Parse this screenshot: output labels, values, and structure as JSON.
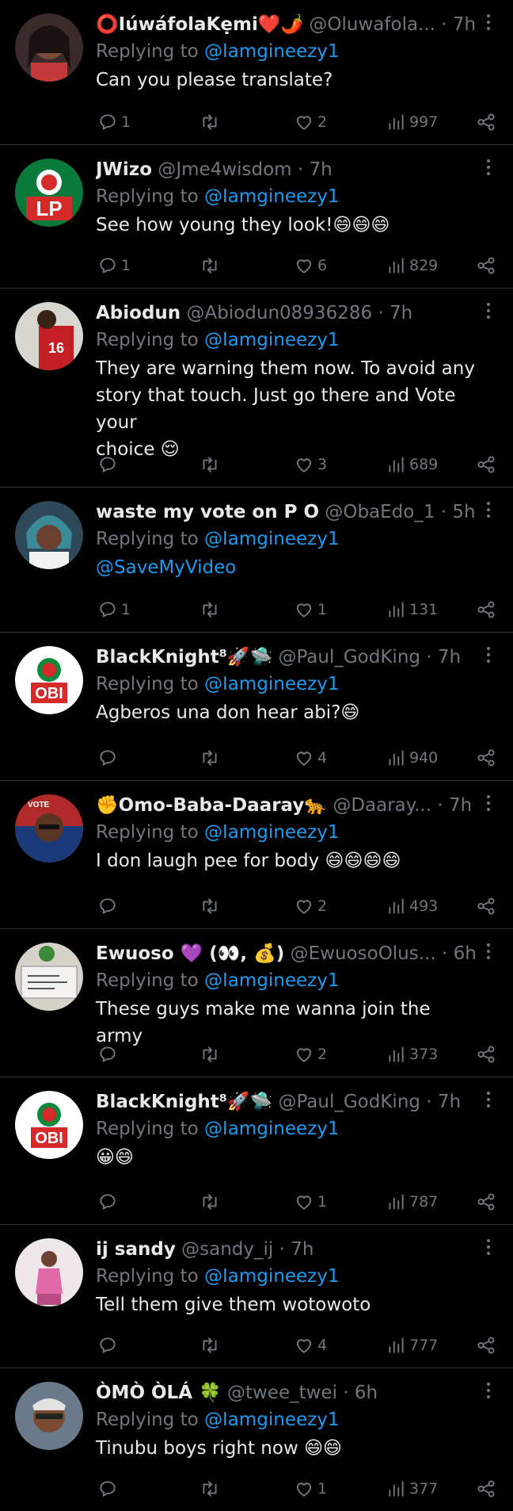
{
  "colors": {
    "background": "#000000",
    "text": "#e7e9ea",
    "muted": "#71767b",
    "link": "#1d9bf0",
    "divider": "#2f3336"
  },
  "icons": {
    "reply": "speech-bubble-icon",
    "retweet": "retweet-arrows-icon",
    "like": "heart-icon",
    "views": "bar-chart-icon",
    "share": "share-nodes-icon",
    "more": "vertical-dots-icon"
  },
  "tweets": [
    {
      "name": "⭕IúwáfolaKẹmi❤️🌶️",
      "handle": "@Oluwafola...",
      "time": "· 7h",
      "replying_prefix": "Replying to ",
      "replying_to": "@Iamgineezy1",
      "text": "Can you please translate?",
      "replies": "1",
      "retweets": "",
      "likes": "2",
      "views": "997"
    },
    {
      "name": "JWizo",
      "handle": "@Jme4wisdom",
      "time": "· 7h",
      "replying_prefix": "Replying to ",
      "replying_to": "@Iamgineezy1",
      "text": "See how young they look!😄😄😄",
      "replies": "1",
      "retweets": "",
      "likes": "6",
      "views": "829"
    },
    {
      "name": "Abiodun",
      "handle": "@Abiodun08936286",
      "time": "· 7h",
      "replying_prefix": "Replying to ",
      "replying_to": "@Iamgineezy1",
      "text": "They are warning them now. To avoid any\nstory that touch. Just go there and Vote your\nchoice 😌",
      "replies": "",
      "retweets": "",
      "likes": "3",
      "views": "689"
    },
    {
      "name": "waste my vote on P O",
      "handle": "@ObaEdo_1",
      "time": "· 5h",
      "replying_prefix": "Replying to ",
      "replying_to": "@Iamgineezy1",
      "text": "@SaveMyVideo",
      "text_is_link": true,
      "replies": "1",
      "retweets": "",
      "likes": "1",
      "views": "131"
    },
    {
      "name": "BlackKnight⁸🚀🛸",
      "handle": "@Paul_GodKing",
      "time": "· 7h",
      "replying_prefix": "Replying to ",
      "replying_to": "@Iamgineezy1",
      "text": "Agberos una don hear abi?😄",
      "replies": "",
      "retweets": "",
      "likes": "4",
      "views": "940"
    },
    {
      "name": "✊Omo-Baba-Daaray🐆",
      "handle": "@Daaray...",
      "time": "· 7h",
      "replying_prefix": "Replying to ",
      "replying_to": "@Iamgineezy1",
      "text": "I don laugh pee for body 😄😄😄😄",
      "replies": "",
      "retweets": "",
      "likes": "2",
      "views": "493"
    },
    {
      "name": "Ewuoso 💜 (👀, 💰)",
      "handle": "@EwuosoOlus...",
      "time": "· 6h",
      "replying_prefix": "Replying to ",
      "replying_to": "@Iamgineezy1",
      "text": "These guys make me wanna join the army",
      "replies": "",
      "retweets": "",
      "likes": "2",
      "views": "373"
    },
    {
      "name": "BlackKnight⁸🚀🛸",
      "handle": "@Paul_GodKing",
      "time": "· 7h",
      "replying_prefix": "Replying to ",
      "replying_to": "@Iamgineezy1",
      "text": "😀😄",
      "replies": "",
      "retweets": "",
      "likes": "1",
      "views": "787"
    },
    {
      "name": "ij sandy",
      "handle": "@sandy_ij",
      "time": "· 7h",
      "replying_prefix": "Replying to ",
      "replying_to": "@Iamgineezy1",
      "text": "Tell them give them wotowoto",
      "replies": "",
      "retweets": "",
      "likes": "4",
      "views": "777"
    },
    {
      "name": "ÒMÒ ÒLÁ 🍀",
      "handle": "@twee_twei",
      "time": "· 6h",
      "replying_prefix": "Replying to ",
      "replying_to": "@Iamgineezy1",
      "text": "Tinubu boys right now 😄😄",
      "replies": "",
      "retweets": "",
      "likes": "1",
      "views": "377"
    }
  ]
}
